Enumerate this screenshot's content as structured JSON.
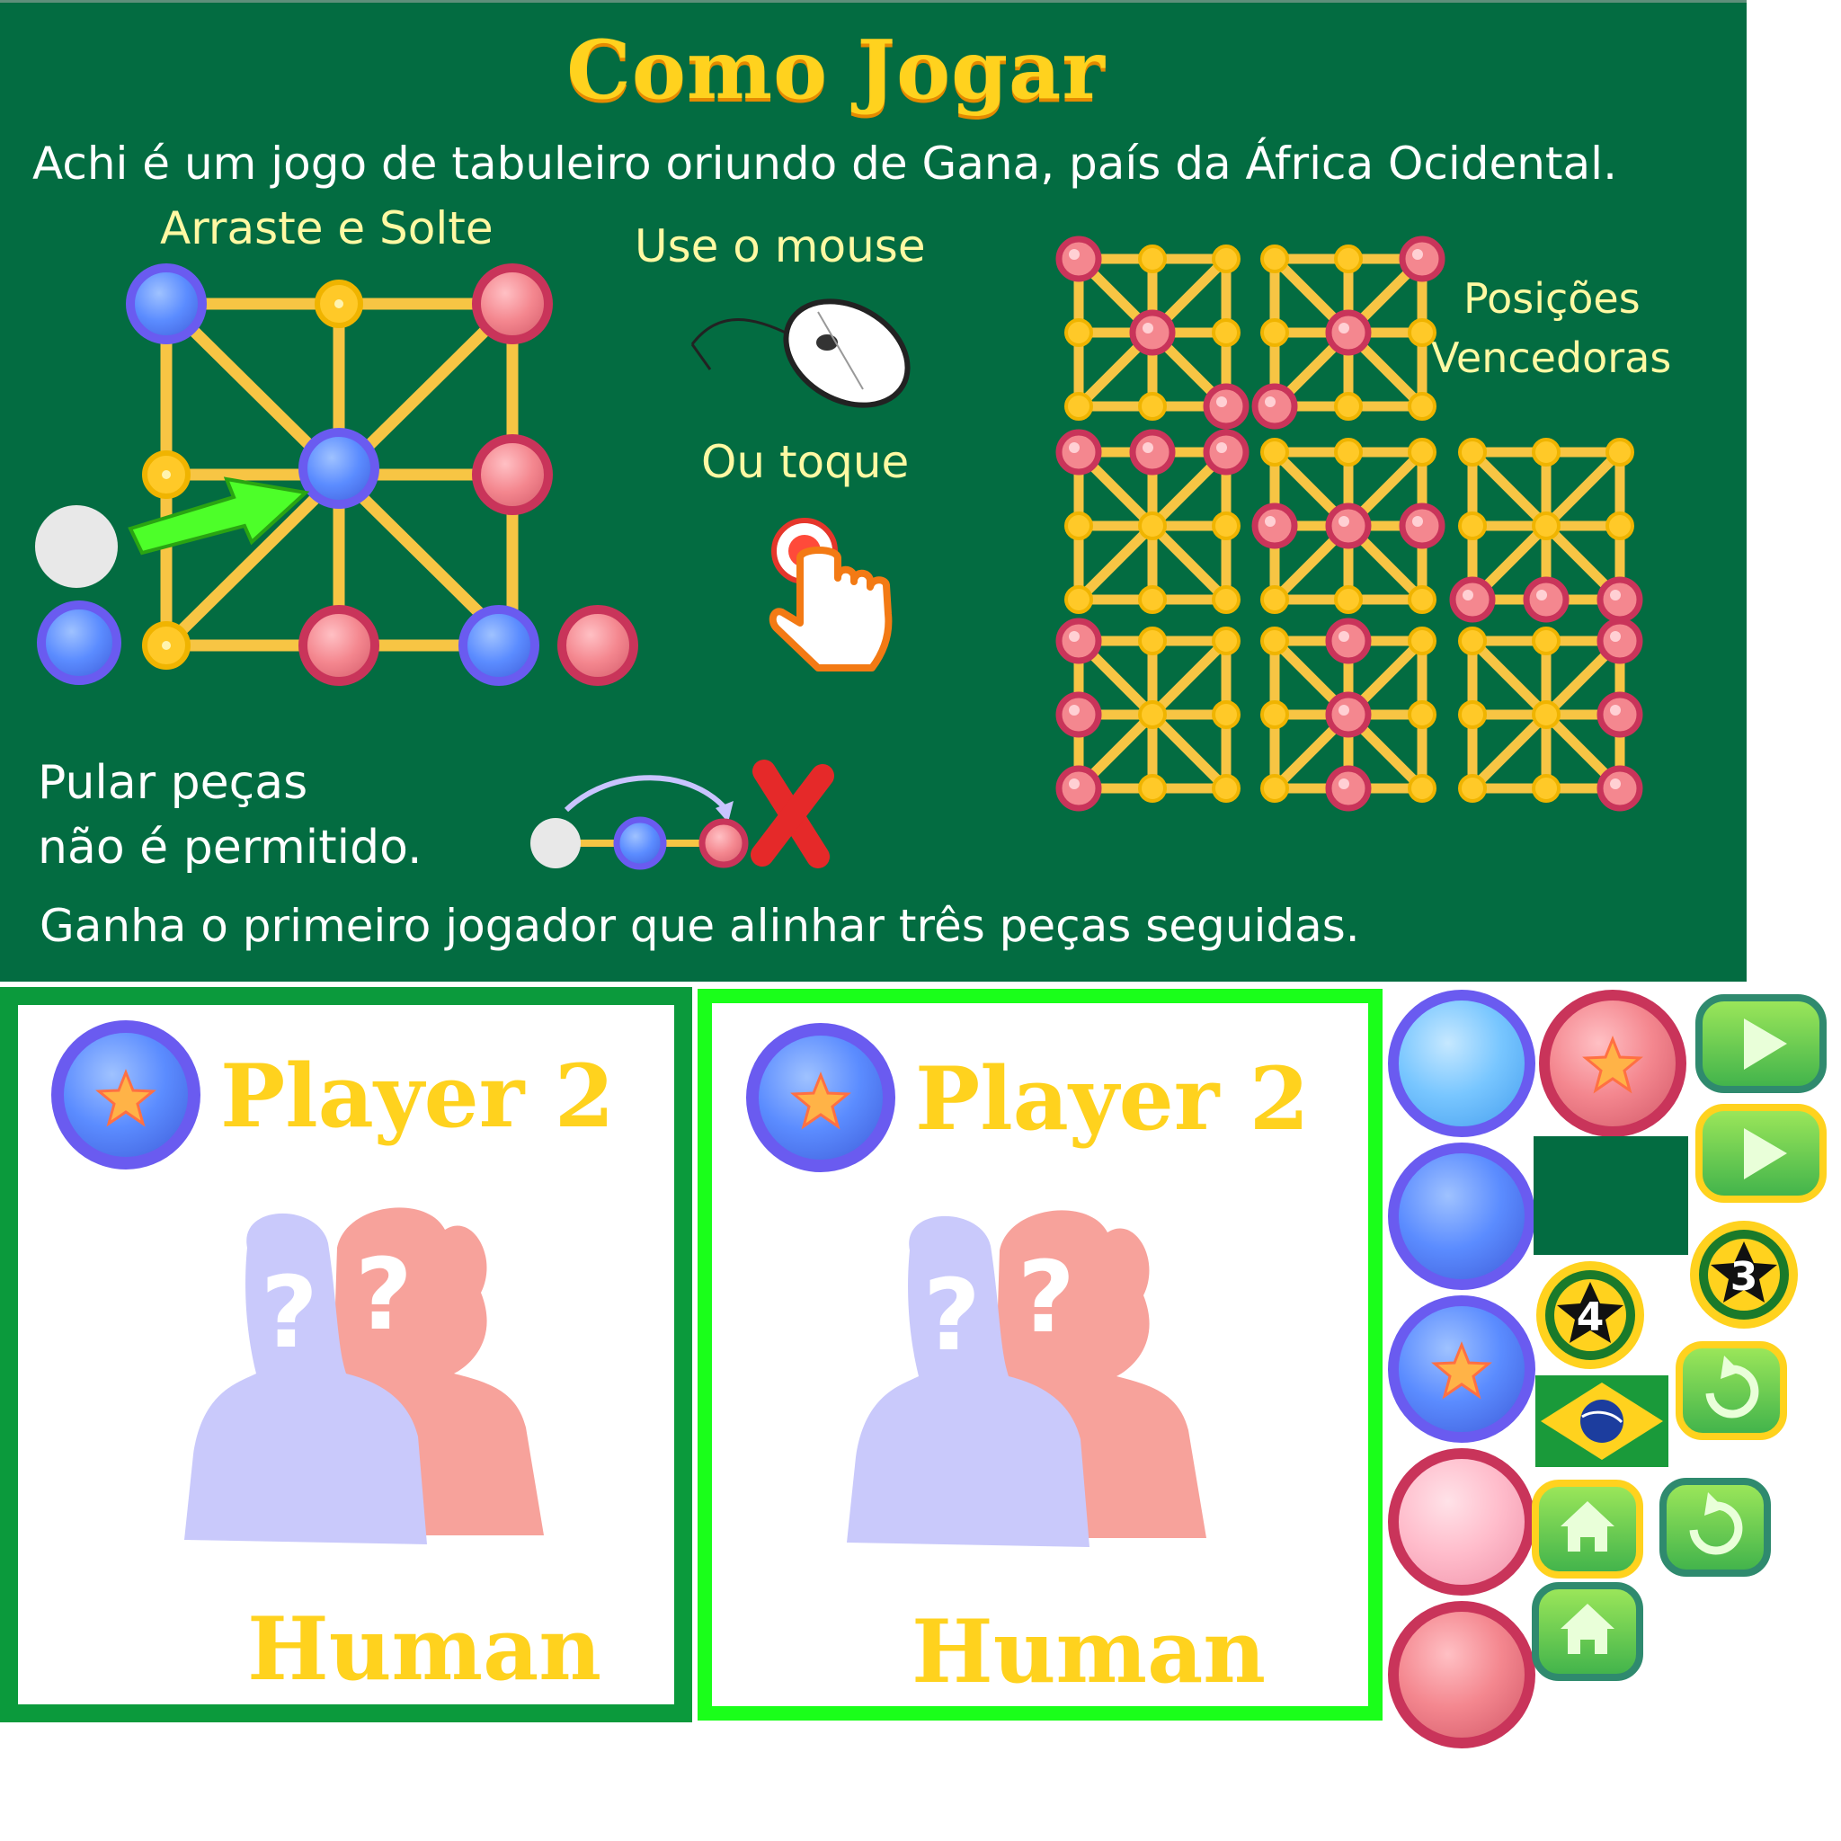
{
  "howto": {
    "title": "Como Jogar",
    "intro": "Achi é um jogo de tabuleiro oriundo de Gana, país da África Ocidental.",
    "drag_label": "Arraste e Solte",
    "mouse_label": "Use o mouse",
    "touch_label": "Ou toque",
    "win_label_line1": "Posições",
    "win_label_line2": "Vencedoras",
    "jump_line1": "Pular peças",
    "jump_line2": "não é permitido.",
    "win_rule": "Ganha o primeiro jogador que alinhar três peças seguidas."
  },
  "players": [
    {
      "name": "Player 2",
      "type": "Human"
    },
    {
      "name": "Player 2",
      "type": "Human"
    }
  ],
  "sprites": {
    "badge_4": "4",
    "badge_3": "3"
  },
  "colors": {
    "board_bg": "#036c41",
    "title_yellow": "#ffd21e",
    "blue_piece": "#5b8cff",
    "red_piece": "#f4878f",
    "panel_border_dark": "#0b9a3c",
    "panel_border_bright": "#1aff1a"
  }
}
